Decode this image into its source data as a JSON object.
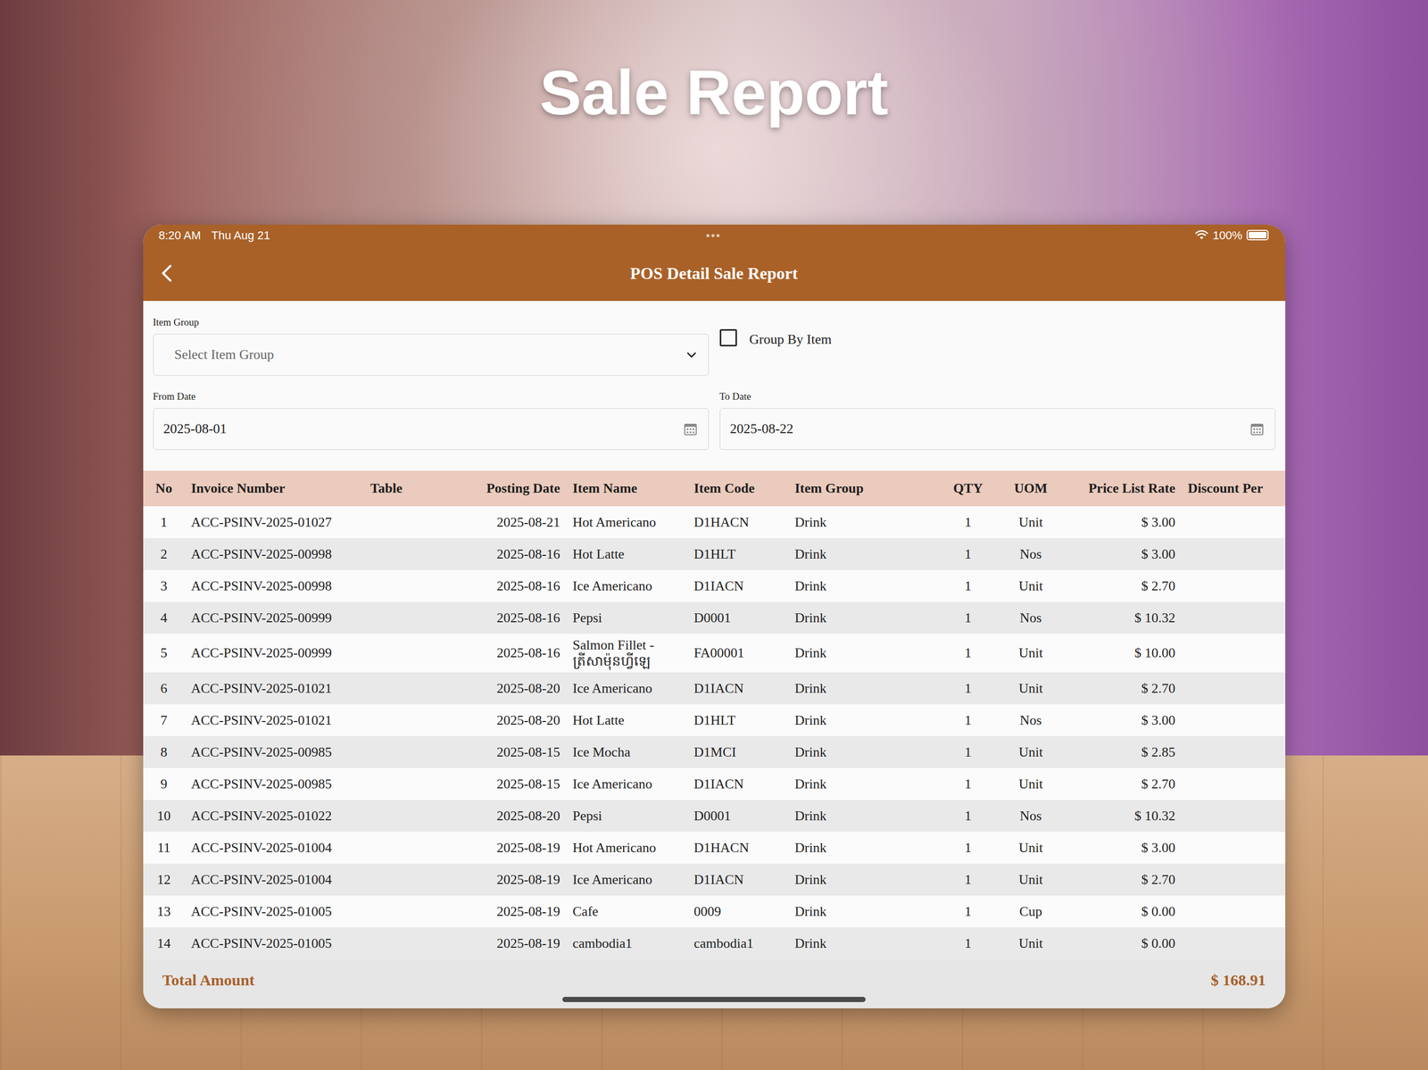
{
  "hero": {
    "title": "Sale Report"
  },
  "status_bar": {
    "time": "8:20 AM",
    "date": "Thu Aug 21",
    "dots": "•••",
    "battery": "100%",
    "battery_level": 1
  },
  "header": {
    "title": "POS Detail Sale Report"
  },
  "filters": {
    "item_group": {
      "label": "Item Group",
      "placeholder": "Select Item Group"
    },
    "group_by_item": {
      "label": "Group By Item",
      "checked": false
    },
    "from_date": {
      "label": "From Date",
      "value": "2025-08-01"
    },
    "to_date": {
      "label": "To Date",
      "value": "2025-08-22"
    }
  },
  "table": {
    "columns": [
      "No",
      "Invoice Number",
      "Table",
      "Posting Date",
      "Item Name",
      "Item Code",
      "Item Group",
      "QTY",
      "UOM",
      "Price List Rate",
      "Discount Per"
    ],
    "rows": [
      {
        "no": "1",
        "invoice": "ACC-PSINV-2025-01027",
        "date": "2025-08-21",
        "item_name": "Hot Americano",
        "item_code": "D1HACN",
        "item_group": "Drink",
        "qty": "1",
        "uom": "Unit",
        "rate": "$ 3.00"
      },
      {
        "no": "2",
        "invoice": "ACC-PSINV-2025-00998",
        "date": "2025-08-16",
        "item_name": "Hot Latte",
        "item_code": "D1HLT",
        "item_group": "Drink",
        "qty": "1",
        "uom": "Nos",
        "rate": "$ 3.00"
      },
      {
        "no": "3",
        "invoice": "ACC-PSINV-2025-00998",
        "date": "2025-08-16",
        "item_name": "Ice Americano",
        "item_code": "D1IACN",
        "item_group": "Drink",
        "qty": "1",
        "uom": "Unit",
        "rate": "$ 2.70"
      },
      {
        "no": "4",
        "invoice": "ACC-PSINV-2025-00999",
        "date": "2025-08-16",
        "item_name": "Pepsi",
        "item_code": "D0001",
        "item_group": "Drink",
        "qty": "1",
        "uom": "Nos",
        "rate": "$ 10.32"
      },
      {
        "no": "5",
        "invoice": "ACC-PSINV-2025-00999",
        "date": "2025-08-16",
        "item_name": "Salmon Fillet - ត្រីសាម៉ុនហ្វីឡេ",
        "item_code": "FA00001",
        "item_group": "Drink",
        "qty": "1",
        "uom": "Unit",
        "rate": "$ 10.00"
      },
      {
        "no": "6",
        "invoice": "ACC-PSINV-2025-01021",
        "date": "2025-08-20",
        "item_name": "Ice Americano",
        "item_code": "D1IACN",
        "item_group": "Drink",
        "qty": "1",
        "uom": "Unit",
        "rate": "$ 2.70"
      },
      {
        "no": "7",
        "invoice": "ACC-PSINV-2025-01021",
        "date": "2025-08-20",
        "item_name": "Hot Latte",
        "item_code": "D1HLT",
        "item_group": "Drink",
        "qty": "1",
        "uom": "Nos",
        "rate": "$ 3.00"
      },
      {
        "no": "8",
        "invoice": "ACC-PSINV-2025-00985",
        "date": "2025-08-15",
        "item_name": "Ice Mocha",
        "item_code": "D1MCI",
        "item_group": "Drink",
        "qty": "1",
        "uom": "Unit",
        "rate": "$ 2.85"
      },
      {
        "no": "9",
        "invoice": "ACC-PSINV-2025-00985",
        "date": "2025-08-15",
        "item_name": "Ice Americano",
        "item_code": "D1IACN",
        "item_group": "Drink",
        "qty": "1",
        "uom": "Unit",
        "rate": "$ 2.70"
      },
      {
        "no": "10",
        "invoice": "ACC-PSINV-2025-01022",
        "date": "2025-08-20",
        "item_name": "Pepsi",
        "item_code": "D0001",
        "item_group": "Drink",
        "qty": "1",
        "uom": "Nos",
        "rate": "$ 10.32"
      },
      {
        "no": "11",
        "invoice": "ACC-PSINV-2025-01004",
        "date": "2025-08-19",
        "item_name": "Hot Americano",
        "item_code": "D1HACN",
        "item_group": "Drink",
        "qty": "1",
        "uom": "Unit",
        "rate": "$ 3.00"
      },
      {
        "no": "12",
        "invoice": "ACC-PSINV-2025-01004",
        "date": "2025-08-19",
        "item_name": "Ice Americano",
        "item_code": "D1IACN",
        "item_group": "Drink",
        "qty": "1",
        "uom": "Unit",
        "rate": "$ 2.70"
      },
      {
        "no": "13",
        "invoice": "ACC-PSINV-2025-01005",
        "date": "2025-08-19",
        "item_name": "Cafe",
        "item_code": "0009",
        "item_group": "Drink",
        "qty": "1",
        "uom": "Cup",
        "rate": "$ 0.00"
      },
      {
        "no": "14",
        "invoice": "ACC-PSINV-2025-01005",
        "date": "2025-08-19",
        "item_name": "cambodia1",
        "item_code": "cambodia1",
        "item_group": "Drink",
        "qty": "1",
        "uom": "Unit",
        "rate": "$ 0.00"
      }
    ]
  },
  "total": {
    "label": "Total Amount",
    "value": "$ 168.91"
  }
}
